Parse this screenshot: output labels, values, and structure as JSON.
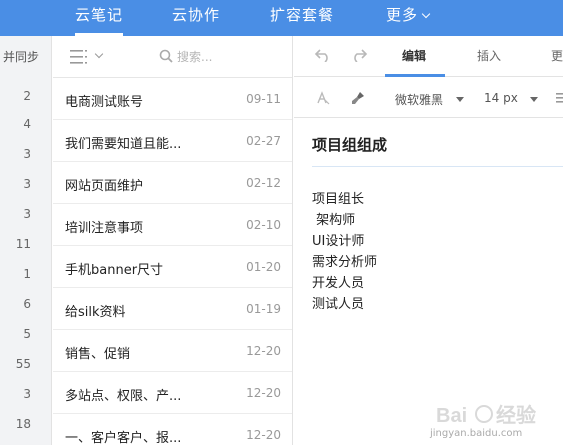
{
  "topnav": {
    "tabs": [
      {
        "label": "云笔记"
      },
      {
        "label": "云协作"
      },
      {
        "label": "扩容套餐"
      },
      {
        "label": "更多"
      }
    ]
  },
  "countcol": {
    "sync_label": "并同步",
    "counts": [
      "2",
      "4",
      "3",
      "3",
      "3",
      "11",
      "1",
      "6",
      "5",
      "55",
      "3",
      "18"
    ]
  },
  "list": {
    "search_placeholder": "搜索...",
    "notes": [
      {
        "title": "电商测试账号",
        "date": "09-11"
      },
      {
        "title": "我们需要知道且能...",
        "date": "02-27"
      },
      {
        "title": "网站页面维护",
        "date": "02-12"
      },
      {
        "title": "培训注意事项",
        "date": "02-10"
      },
      {
        "title": "手机banner尺寸",
        "date": "01-20"
      },
      {
        "title": "给silk资料",
        "date": "01-19"
      },
      {
        "title": "销售、促销",
        "date": "12-20"
      },
      {
        "title": "多站点、权限、产...",
        "date": "12-20"
      },
      {
        "title": "一、客户客户、报...",
        "date": "12-20"
      }
    ]
  },
  "editor": {
    "tabs": [
      "编辑",
      "插入",
      "更"
    ],
    "font_family": "微软雅黑",
    "font_size": "14 px",
    "doc_title": "项目组组成",
    "lines": [
      "项目组长",
      " 架构师",
      "UI设计师",
      "需求分析师",
      "开发人员",
      "测试人员"
    ]
  },
  "watermark": {
    "text": "jingyan.baidu.com"
  },
  "colors": {
    "brand_blue": "#4a8ee5"
  }
}
